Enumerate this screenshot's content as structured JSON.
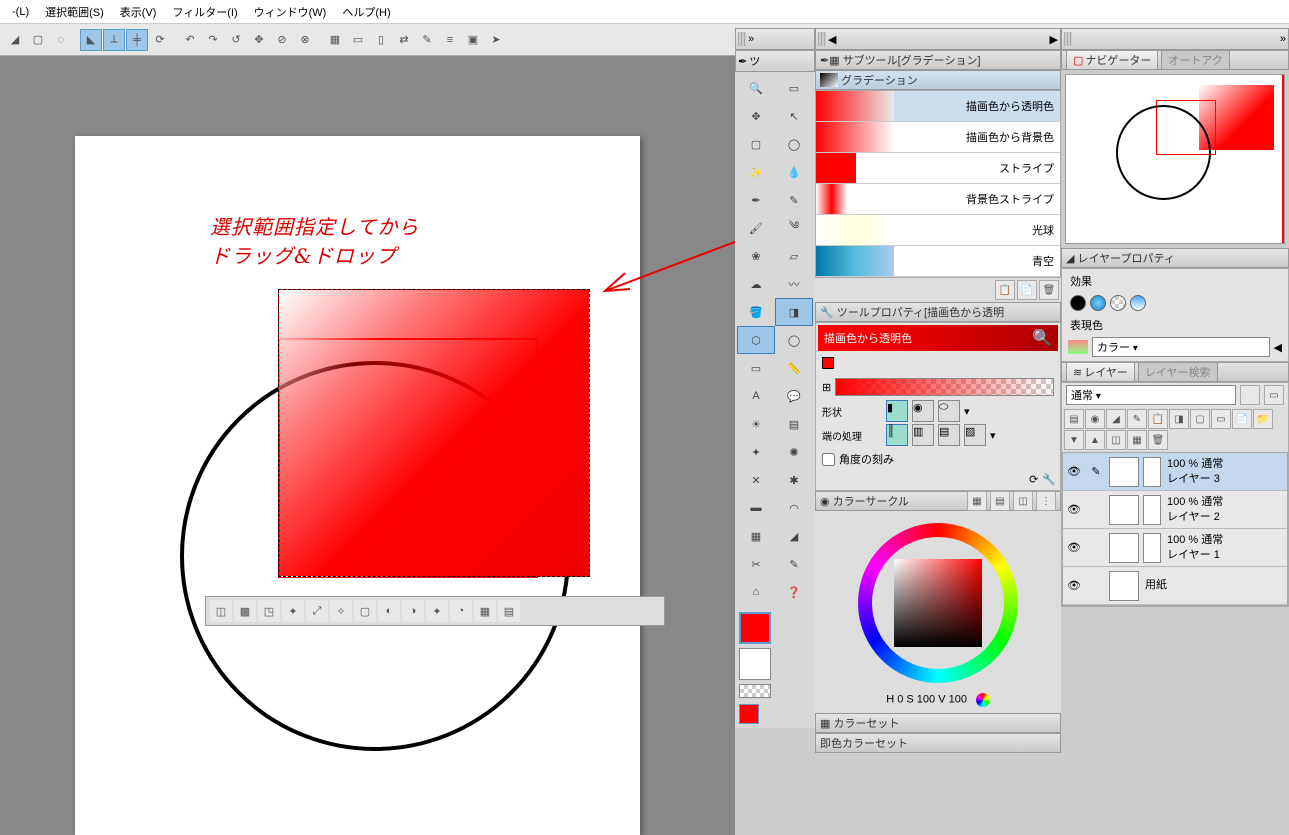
{
  "menu": {
    "l": "-(L)",
    "sel": "選択範囲(S)",
    "view": "表示(V)",
    "filter": "フィルター(I)",
    "window": "ウィンドウ(W)",
    "help": "ヘルプ(H)"
  },
  "annotation": "選択範囲指定してから\nドラッグ&ドロップ",
  "subtool": {
    "title": "サブツール[グラデーション]",
    "tab": "グラデーション"
  },
  "gradients": [
    {
      "name": "描画色から透明色",
      "css": "linear-gradient(90deg,#f00,rgba(255,0,0,0))"
    },
    {
      "name": "描画色から背景色",
      "css": "linear-gradient(90deg,#f00,#fff)"
    },
    {
      "name": "ストライプ",
      "css": "repeating-linear-gradient(90deg,#f00 0 40px,#fff 40px 80px)"
    },
    {
      "name": "背景色ストライプ",
      "css": "linear-gradient(90deg,#fff,#f00 20%,#fff 40%,#fff)"
    },
    {
      "name": "光球",
      "css": "linear-gradient(90deg,#fff,#ffd,#fff)"
    },
    {
      "name": "青空",
      "css": "linear-gradient(90deg,#07a,#5bd,#ace)"
    }
  ],
  "toolprop": {
    "title": "ツールプロパティ[描画色から透明",
    "current": "描画色から透明色",
    "shape": "形状",
    "edge": "端の処理",
    "angle": "角度の刻み"
  },
  "colorcircle": {
    "title": "カラーサークル",
    "readout": "H    0 S 100 V 100"
  },
  "navigator": {
    "title": "ナビゲーター",
    "auto": "オートアク"
  },
  "layerprop": {
    "title": "レイヤープロパティ",
    "effect": "効果",
    "exprcolor": "表現色",
    "color": "カラー"
  },
  "layers": {
    "title": "レイヤー",
    "search": "レイヤー検索",
    "blend": "通常",
    "items": [
      {
        "opacity": "100 % 通常",
        "name": "レイヤー 3"
      },
      {
        "opacity": "100 % 通常",
        "name": "レイヤー 2"
      },
      {
        "opacity": "100 % 通常",
        "name": "レイヤー 1"
      },
      {
        "opacity": "",
        "name": "用紙"
      }
    ]
  },
  "colorset": {
    "title": "カラーセット",
    "quick": "即色カラーセット"
  },
  "tooltab": "ツ"
}
